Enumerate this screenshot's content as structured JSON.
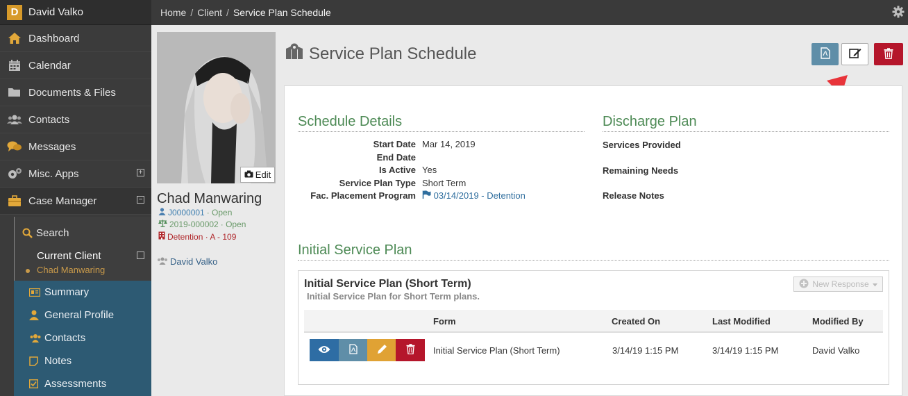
{
  "sidebar": {
    "brand_initial": "D",
    "user_name": "David Valko",
    "items": [
      {
        "label": "Dashboard",
        "icon": "home-icon"
      },
      {
        "label": "Calendar",
        "icon": "calendar-icon"
      },
      {
        "label": "Documents & Files",
        "icon": "folder-icon"
      },
      {
        "label": "Contacts",
        "icon": "users-icon"
      },
      {
        "label": "Messages",
        "icon": "comments-icon"
      },
      {
        "label": "Misc. Apps",
        "icon": "cogs-icon"
      },
      {
        "label": "Case Manager",
        "icon": "briefcase-icon"
      }
    ],
    "search_label": "Search",
    "current_client_label": "Current Client",
    "current_client_name": "Chad Manwaring",
    "client_items": [
      {
        "label": "Summary",
        "icon": "id-card-icon"
      },
      {
        "label": "General Profile",
        "icon": "user-icon"
      },
      {
        "label": "Contacts",
        "icon": "users-icon"
      },
      {
        "label": "Notes",
        "icon": "note-icon"
      },
      {
        "label": "Assessments",
        "icon": "checkbox-icon"
      }
    ]
  },
  "breadcrumb": {
    "home": "Home",
    "client": "Client",
    "current": "Service Plan Schedule"
  },
  "profile": {
    "edit_label": "Edit",
    "name": "Chad Manwaring",
    "case1_id": "J0000001",
    "case1_status": "· Open",
    "case2_id": "2019-000002",
    "case2_status": "· Open",
    "placement": "Detention · A - 109",
    "worker": "David Valko"
  },
  "page": {
    "title": "Service Plan Schedule"
  },
  "schedule": {
    "title": "Schedule Details",
    "rows": [
      {
        "label": "Start Date",
        "value": "Mar 14, 2019"
      },
      {
        "label": "End Date",
        "value": ""
      },
      {
        "label": "Is Active",
        "value": "Yes"
      },
      {
        "label": "Service Plan Type",
        "value": "Short Term"
      },
      {
        "label": "Fac. Placement Program",
        "value": "03/14/2019 - Detention"
      }
    ]
  },
  "discharge": {
    "title": "Discharge Plan",
    "services": "Services Provided",
    "needs": "Remaining Needs",
    "notes": "Release Notes"
  },
  "isp": {
    "section_title": "Initial Service Plan",
    "box_title": "Initial Service Plan (Short Term)",
    "box_desc": "Initial Service Plan for Short Term plans.",
    "new_response": "New Response",
    "columns": [
      "Form",
      "Created On",
      "Last Modified",
      "Modified By"
    ],
    "row": {
      "form": "Initial Service Plan (Short Term)",
      "created": "3/14/19 1:15 PM",
      "modified": "3/14/19 1:15 PM",
      "modified_by": "David Valko"
    }
  },
  "colors": {
    "sidebar_bg": "#3b3b3b",
    "accent_green": "#4d8a55",
    "pdf_btn": "#5f8ea8",
    "view_btn": "#2e6da4",
    "edit_btn": "#e0a234",
    "delete_btn": "#b5162b",
    "arrow": "#e8343a"
  }
}
